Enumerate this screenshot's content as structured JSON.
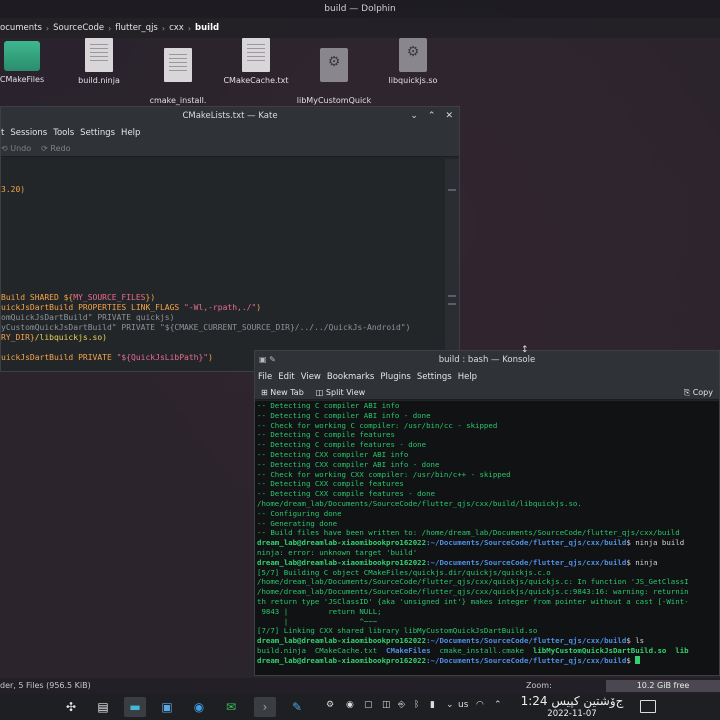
{
  "dolphin": {
    "title": "build — Dolphin",
    "breadcrumb": [
      "ocuments",
      "SourceCode",
      "flutter_qjs",
      "cxx",
      "build"
    ],
    "files": [
      {
        "name": "CMakeFiles",
        "icon": "folder-icon"
      },
      {
        "name": "build.ninja",
        "icon": "text-file-icon"
      },
      {
        "name": "cmake_install.\ncmake",
        "icon": "text-file-icon"
      },
      {
        "name": "CMakeCache.txt",
        "icon": "text-file-icon"
      },
      {
        "name": "libMyCustomQuick\nJsDartBuild.so",
        "icon": "shared-library-icon"
      },
      {
        "name": "libquickjs.so",
        "icon": "shared-library-icon"
      }
    ],
    "status_left": "der, 5 Files (956.5 KiB)",
    "zoom_label": "Zoom:",
    "free_space": "10.2 GiB free"
  },
  "kate": {
    "title": "CMakeLists.txt — Kate",
    "menu": [
      "t",
      "Sessions",
      "Tools",
      "Settings",
      "Help"
    ],
    "undo": "Undo",
    "redo": "Redo",
    "code": {
      "l1": "3.20)",
      "l2a": "Build SHARED ${",
      "l2b": "MY_SOURCE_FILES",
      "l2c": "})",
      "l3a": "uickJsDartBuild PROPERTIES LINK_FLAGS ",
      "l3b": "\"-Wl,-rpath,./\"",
      "l3c": ")",
      "l4": "omQuickJsDartBuild\" PRIVATE quickjs)",
      "l5": "yCustomQuickJsDartBuild\" PRIVATE \"${CMAKE_CURRENT_SOURCE_DIR}/../../QuickJs-Android\")",
      "l6a": "RY_DIR}",
      "l6b": "/libquickjs.so)",
      "l7a": "uickJsDartBuild PRIVATE ",
      "l7b": "\"${QuickJsLibPath}\"",
      "l7c": ")"
    }
  },
  "konsole": {
    "title": "build : bash — Konsole",
    "menu": [
      "File",
      "Edit",
      "View",
      "Bookmarks",
      "Plugins",
      "Settings",
      "Help"
    ],
    "new_tab": "New Tab",
    "split_view": "Split View",
    "copy": "Copy",
    "prompt_user": "dream_lab@dreamlab-xiaomibookpro162022",
    "prompt_path": ":~/Documents/SourceCode/flutter_qjs/cxx/build",
    "lines": {
      "o1": "-- Detecting C compiler ABI info",
      "o2": "-- Detecting C compiler ABI info - done",
      "o3": "-- Check for working C compiler: /usr/bin/cc - skipped",
      "o4": "-- Detecting C compile features",
      "o5": "-- Detecting C compile features - done",
      "o6": "-- Detecting CXX compiler ABI info",
      "o7": "-- Detecting CXX compiler ABI info - done",
      "o8": "-- Check for working CXX compiler: /usr/bin/c++ - skipped",
      "o9": "-- Detecting CXX compile features",
      "o10": "-- Detecting CXX compile features - done",
      "o11": "/home/dream_lab/Documents/SourceCode/flutter_qjs/cxx/build/libquickjs.so.",
      "o12": "-- Configuring done",
      "o13": "-- Generating done",
      "o14": "-- Build files have been written to: /home/dream_lab/Documents/SourceCode/flutter_qjs/cxx/build",
      "cmd1": "$ ninja build",
      "o15": "ninja: error: unknown target 'build'",
      "cmd2": "$ ninja",
      "o16": "[5/7] Building C object CMakeFiles/quickjs.dir/quickjs/quickjs.c.o",
      "o17": "/home/dream_lab/Documents/SourceCode/flutter_qjs/cxx/quickjs/quickjs.c: In function 'JS_GetClassI",
      "o18": "/home/dream_lab/Documents/SourceCode/flutter_qjs/cxx/quickjs/quickjs.c:9843:16: warning: returnin",
      "o19": "th return type 'JSClassID' {aka 'unsigned int'} makes integer from pointer without a cast [-Wint-",
      "o20": " 9843 |         return NULL;",
      "o21": "      |                ^~~~",
      "o22": "[7/7] Linking CXX shared library libMyCustomQuickJsDartBuild.so",
      "cmd3": "$ ls",
      "ls_a": "build.ninja  CMakeCache.txt  ",
      "ls_b": "CMakeFiles",
      "ls_c": "  cmake_install.cmake  ",
      "ls_d": "libMyCustomQuickJsDartBuild.so  lib",
      "cmd4": "$ "
    }
  },
  "taskbar": {
    "keyboard_layout": "us",
    "time": "1:24 ﺝۆشتین كپیس",
    "date": "2022-11-07"
  }
}
